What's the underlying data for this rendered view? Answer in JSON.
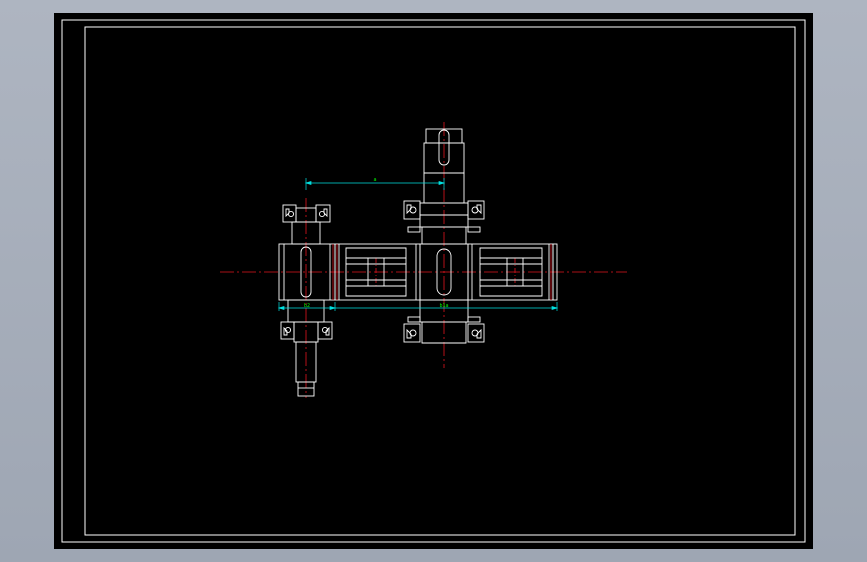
{
  "window": {
    "background": "#a5acb8",
    "sheet_color": "#000000",
    "border_color": "#ffffff"
  },
  "colors": {
    "geometry": "#ffffff",
    "centerline": "#e0141e",
    "dimension": "#00e0e0",
    "dimension_text": "#00ff00"
  },
  "dimensions": {
    "center_distance": "a",
    "left_gear_width": "b2",
    "right_gear_width": "b1a"
  }
}
